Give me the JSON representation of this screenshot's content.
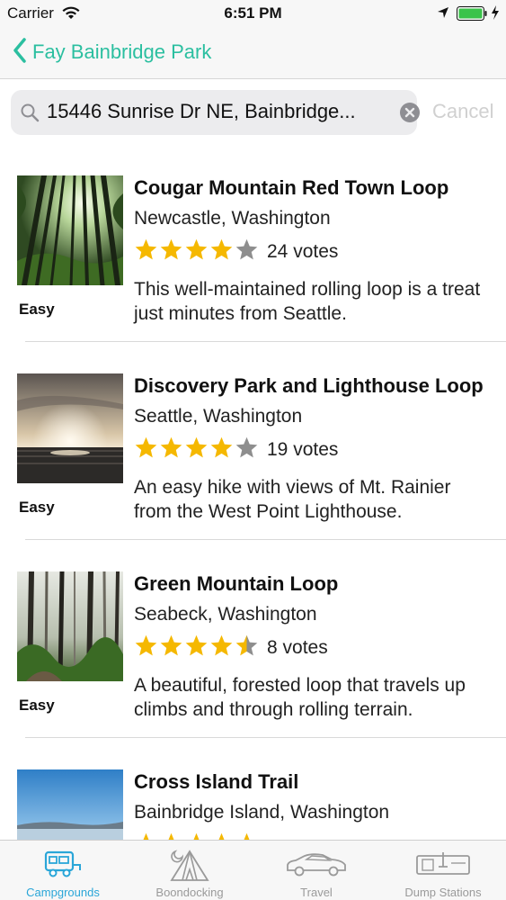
{
  "status": {
    "carrier": "Carrier",
    "time": "6:51 PM"
  },
  "nav": {
    "back_label": "Fay Bainbridge Park"
  },
  "search": {
    "value": "15446 Sunrise Dr NE, Bainbridge...",
    "cancel": "Cancel"
  },
  "colors": {
    "accent": "#2bbfa0",
    "tab_active": "#2aa6d8",
    "star": "#f5b800",
    "star_empty": "#8e8e8e"
  },
  "trails": [
    {
      "title": "Cougar Mountain Red Town Loop",
      "location": "Newcastle, Washington",
      "rating": 4,
      "votes": "24 votes",
      "description": "This well-maintained rolling loop is a treat just minutes from Seattle.",
      "difficulty": "Easy",
      "image": "forest-sunlight"
    },
    {
      "title": "Discovery Park and Lighthouse Loop",
      "location": "Seattle, Washington",
      "rating": 4,
      "votes": "19 votes",
      "description": "An easy hike with views of Mt. Rainier from the West Point Lighthouse.",
      "difficulty": "Easy",
      "image": "sunset-water"
    },
    {
      "title": "Green Mountain Loop",
      "location": "Seabeck, Washington",
      "rating": 4.5,
      "votes": "8 votes",
      "description": "A beautiful, forested loop that travels up climbs and through rolling terrain.",
      "difficulty": "Easy",
      "image": "misty-forest"
    },
    {
      "title": "Cross Island Trail",
      "location": "Bainbridge Island, Washington",
      "rating": 5,
      "votes": "",
      "description": "",
      "difficulty": "",
      "image": "sky-water"
    }
  ],
  "tabs": [
    {
      "label": "Campgrounds",
      "icon": "rv-icon",
      "active": true
    },
    {
      "label": "Boondocking",
      "icon": "tent-icon",
      "active": false
    },
    {
      "label": "Travel",
      "icon": "car-icon",
      "active": false
    },
    {
      "label": "Dump Stations",
      "icon": "dump-station-icon",
      "active": false
    }
  ]
}
